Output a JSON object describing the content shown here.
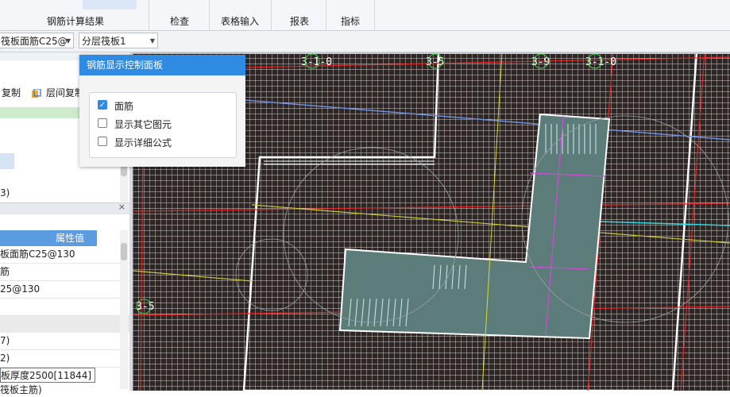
{
  "ribbon": {
    "tabs": [
      {
        "label": "钢筋计算结果"
      },
      {
        "label": "检查"
      },
      {
        "label": "表格输入"
      },
      {
        "label": "报表"
      },
      {
        "label": "指标"
      }
    ]
  },
  "toolbar": {
    "component_select": "筏板面筋C25@",
    "layer_select": "分层筏板1"
  },
  "left_panel": {
    "copy_label": "复制",
    "floor_copy_label": "层间复制",
    "item_close": "3)",
    "close_icon": "×",
    "props_header": "属性值",
    "props": [
      "板面筋C25@130",
      "筋",
      "25@130",
      "",
      "",
      "7)",
      "2)",
      "板厚度2500[11844]",
      "筏板主筋)"
    ]
  },
  "popup": {
    "title": "钢筋显示控制面板",
    "options": [
      {
        "label": "面筋",
        "checked": true
      },
      {
        "label": "显示其它图元",
        "checked": false
      },
      {
        "label": "显示详细公式",
        "checked": false
      }
    ]
  },
  "cad": {
    "axis_labels": [
      "3-1-0",
      "3-5",
      "3-9",
      "3-1-0",
      "3-5"
    ]
  }
}
